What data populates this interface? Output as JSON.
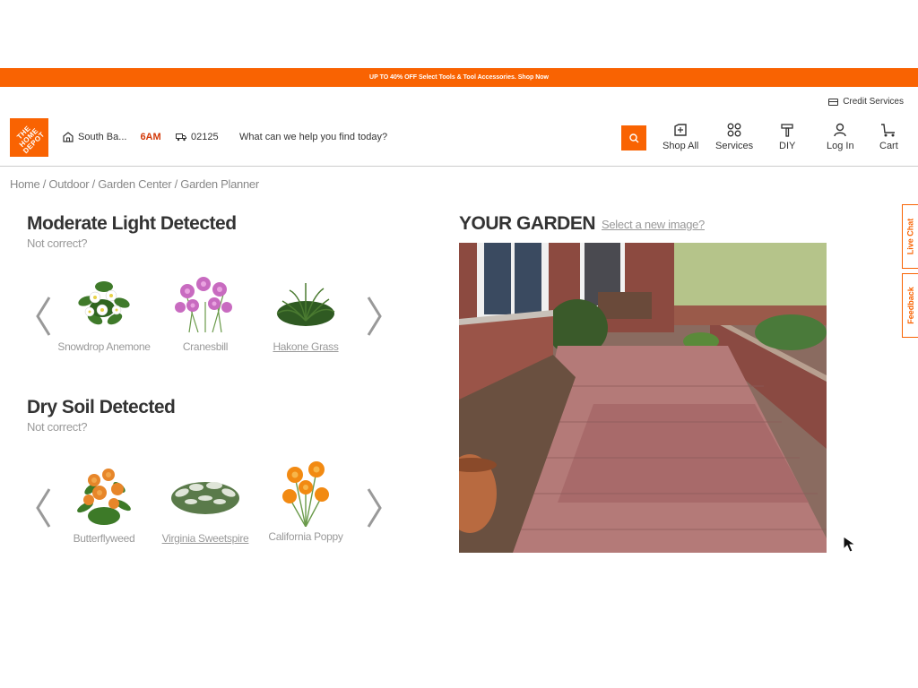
{
  "promo_banner": "UP TO 40% OFF Select Tools & Tool Accessories. Shop Now",
  "credit_services": "Credit Services",
  "logo_text": "THE HOME DEPOT",
  "store": {
    "name": "South Ba...",
    "hours": "6AM"
  },
  "zip": "02125",
  "search": {
    "placeholder": "What can we help you find today?"
  },
  "nav": {
    "shop_all": "Shop All",
    "services": "Services",
    "diy": "DIY",
    "log_in": "Log In",
    "cart": "Cart"
  },
  "breadcrumb": [
    "Home",
    "Outdoor",
    "Garden Center",
    "Garden Planner"
  ],
  "light_section": {
    "title": "Moderate Light Detected",
    "not_correct": "Not correct?",
    "plants": [
      {
        "name": "Snowdrop Anemone",
        "icon": "white-flower-icon"
      },
      {
        "name": "Cranesbill",
        "icon": "pink-flower-icon"
      },
      {
        "name": "Hakone Grass",
        "icon": "grass-icon"
      }
    ]
  },
  "soil_section": {
    "title": "Dry Soil Detected",
    "not_correct": "Not correct?",
    "plants": [
      {
        "name": "Butterflyweed",
        "icon": "orange-flower-icon"
      },
      {
        "name": "Virginia Sweetspire",
        "icon": "shrub-icon"
      },
      {
        "name": "California Poppy",
        "icon": "poppy-icon"
      }
    ]
  },
  "garden": {
    "title": "YOUR GARDEN",
    "select_new": "Select a new image?"
  },
  "side_tabs": {
    "live_chat": "Live Chat",
    "feedback": "Feedback"
  },
  "colors": {
    "brand_orange": "#f96302",
    "hours_red": "#d33a0a"
  }
}
